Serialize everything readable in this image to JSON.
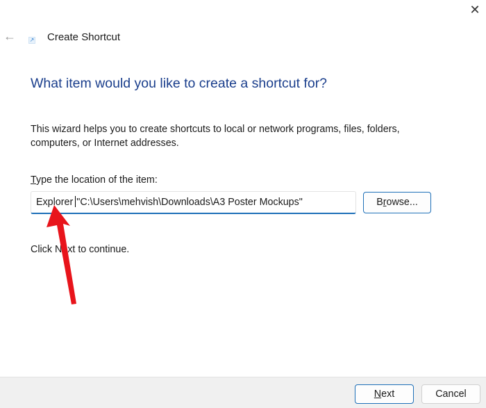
{
  "window": {
    "title": "Create Shortcut",
    "close_icon": "close-icon",
    "back_icon": "back-arrow-icon"
  },
  "heading": "What item would you like to create a shortcut for?",
  "description": "This wizard helps you to create shortcuts to local or network programs, files, folders, computers, or Internet addresses.",
  "location": {
    "label_accel": "T",
    "label_rest": "ype the location of the item:",
    "value_before_caret": "Explorer",
    "value_after_caret": "\"C:\\Users\\mehvish\\Downloads\\A3 Poster Mockups\""
  },
  "browse": {
    "pre": "B",
    "accel": "r",
    "post": "owse..."
  },
  "continue_text": "Click Next to continue.",
  "footer": {
    "next_accel": "N",
    "next_rest": "ext",
    "cancel": "Cancel"
  },
  "annotation": {
    "color": "#e8141b"
  }
}
